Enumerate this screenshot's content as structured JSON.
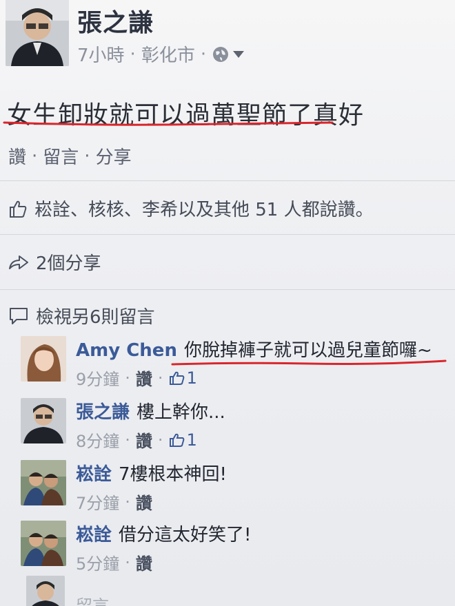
{
  "post": {
    "author": "張之謙",
    "time": "7小時",
    "location": "彰化市",
    "separator": "·",
    "text": "女生卸妝就可以過萬聖節了真好",
    "actions": [
      "讚",
      "留言",
      "分享"
    ],
    "privacy_icon": "globe-icon"
  },
  "stats": {
    "likes_text": "崧詮、核核、李希以及其他 51 人都說讚。",
    "shares_text": "2個分享",
    "view_more_text": "檢視另6則留言"
  },
  "comments": [
    {
      "author": "Amy Chen",
      "text": "你脫掉褲子就可以過兒童節囉~",
      "time": "9分鐘",
      "like_label": "讚",
      "likes": "1"
    },
    {
      "author": "張之謙",
      "text": "樓上幹你...",
      "time": "8分鐘",
      "like_label": "讚",
      "likes": "1"
    },
    {
      "author": "崧詮",
      "text": "7樓根本神回!",
      "time": "7分鐘",
      "like_label": "讚",
      "likes": ""
    },
    {
      "author": "崧詮",
      "text": "借分這太好笑了!",
      "time": "5分鐘",
      "like_label": "讚",
      "likes": ""
    }
  ],
  "reply_placeholder": "留言",
  "colors": {
    "link_blue": "#3b5a98",
    "underline_red": "#d8262c",
    "muted_text": "#9a9fa9"
  }
}
